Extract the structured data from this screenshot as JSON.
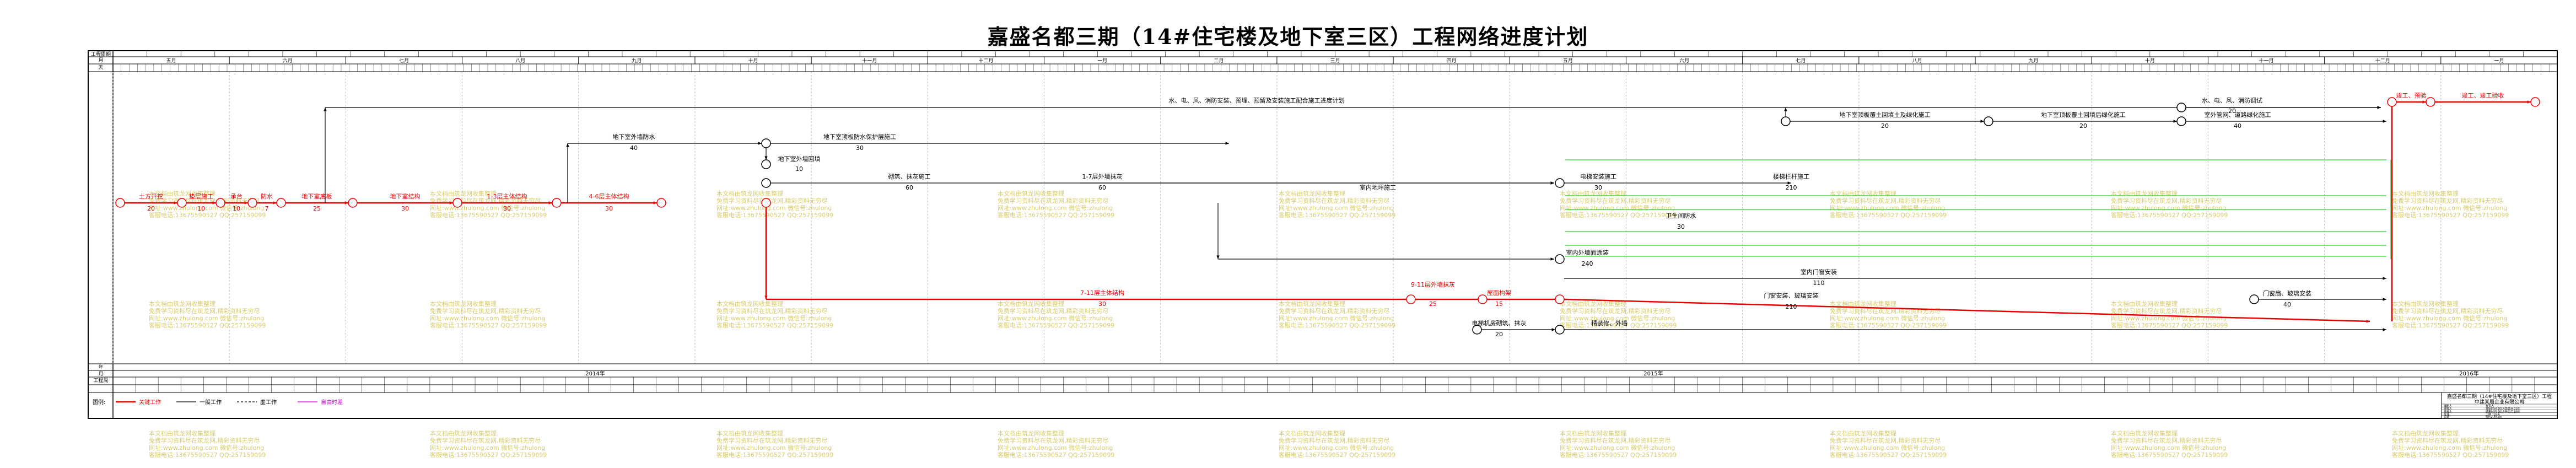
{
  "title": "嘉盛名都三期（14#住宅楼及地下室三区）工程网络进度计划",
  "header": {
    "row_labels": [
      "工程周期",
      "月",
      "天"
    ],
    "months_top": [
      "五月",
      "六月",
      "七月",
      "八月",
      "九月",
      "十月",
      "十一月",
      "十二月",
      "一月",
      "二月",
      "三月",
      "四月",
      "五月",
      "六月",
      "七月",
      "八月",
      "九月",
      "十月",
      "十一月",
      "十二月",
      "一月"
    ]
  },
  "footer": {
    "row_labels": [
      "年",
      "月",
      "工程周"
    ],
    "years": [
      {
        "label": "2014年"
      },
      {
        "label": "2015年"
      },
      {
        "label": "2016年"
      }
    ],
    "legend_label": "图例:",
    "legend_items": [
      {
        "label": "关键工作",
        "color": "#e60000"
      },
      {
        "label": "一般工作",
        "color": "#000000"
      },
      {
        "label": "虚工作",
        "color": "#000000"
      },
      {
        "label": "自由时差",
        "color": "#cc00cc"
      }
    ]
  },
  "watermark": {
    "lines": [
      "本文档由筑龙网收集整理",
      "免费学习资料尽在筑龙网,精彩资料无穷尽",
      "网址:www.zhulong.com 微信号:zhulong",
      "客服电话:13675590527 QQ:257159099"
    ],
    "color": "#d8cc6a"
  },
  "tasks": {
    "main": [
      {
        "label": "土方开挖",
        "dur": "20"
      },
      {
        "label": "垫层施工",
        "dur": "10"
      },
      {
        "label": "承台",
        "dur": "10"
      },
      {
        "label": "防水",
        "dur": "7"
      },
      {
        "label": "地下室底板",
        "dur": "25"
      },
      {
        "label": "地下室结构",
        "dur": "30"
      },
      {
        "label": "1-3层主体结构",
        "dur": "30"
      },
      {
        "label": "4-6层主体结构",
        "dur": "30"
      }
    ],
    "upper": [
      {
        "label": "地下室外墙防水",
        "dur": "40"
      },
      {
        "label": "地下室顶板防水保护层施工",
        "dur": "30"
      },
      {
        "label": "地下室外墙回填",
        "dur": "10"
      },
      {
        "label": "水、电、风、消防安装、预埋、预留及安装施工配合施工进度计划"
      },
      {
        "label": "砌筑、抹灰施工",
        "dur": "60"
      },
      {
        "label": "1-7层外墙抹灰",
        "dur": "60"
      },
      {
        "label": "室内地坪施工",
        "dur": "100"
      },
      {
        "label": "电梯安装施工",
        "dur": "30"
      },
      {
        "label": "楼梯栏杆施工",
        "dur": "210"
      },
      {
        "label": "地下室顶板覆土回填土及绿化施工",
        "dur": "20"
      },
      {
        "label": "地下室顶板覆土回填后绿化施工",
        "dur": "20"
      },
      {
        "label": "水、电、风、消防调试",
        "dur": "20"
      },
      {
        "label": "室外管网、道路绿化施工",
        "dur": "40"
      },
      {
        "label": "竣工、预验",
        "dur": "15"
      },
      {
        "label": "竣工、竣工验收",
        "dur": "5"
      },
      {
        "label": "卫生间防水",
        "dur": "30"
      },
      {
        "label": "室内外墙面涂装",
        "dur": "240"
      },
      {
        "label": "室内门窗安装",
        "dur": "110"
      },
      {
        "label": "门窗安装、玻璃安装",
        "dur": "210"
      },
      {
        "label": "门窗扇、玻璃安装",
        "dur": "40"
      },
      {
        "label": "精装修、外墙",
        "dur": "90"
      }
    ],
    "lower": [
      {
        "label": "7-11层主体结构",
        "dur": "30"
      },
      {
        "label": "9-11层外墙抹灰",
        "dur": "25"
      },
      {
        "label": "屋面构架",
        "dur": "15"
      },
      {
        "label": "屋面装修",
        "dur": "20"
      },
      {
        "label": "电梯机房砌筑、抹灰",
        "dur": "20"
      }
    ]
  },
  "titleblock": {
    "project": "嘉盛名都三期（14#住宅楼及地下室三区）工程",
    "company": "中建某局企业有限公司",
    "rows": [
      {
        "k": "编制人",
        "v": "负责人"
      },
      {
        "k": "审核人",
        "v": "开始时间 2014年05月01日"
      },
      {
        "k": "审批人",
        "v": "结束时间 2016年01月18日"
      },
      {
        "k": "批准",
        "v": "工期 728天"
      },
      {
        "k": "图号",
        "v": "2014-05-08"
      }
    ]
  }
}
